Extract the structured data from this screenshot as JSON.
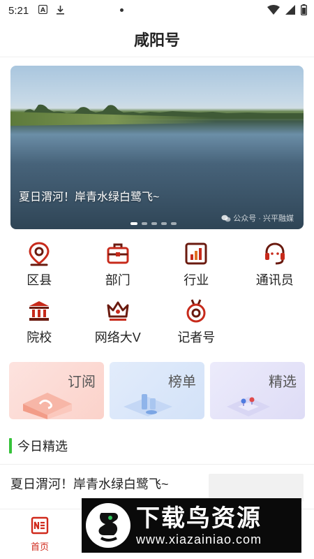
{
  "status_bar": {
    "time": "5:21"
  },
  "header": {
    "title": "咸阳号"
  },
  "banner": {
    "caption": "夏日渭河！岸青水绿白鹭飞~",
    "watermark": "公众号 · 兴平融媒",
    "page_count": 5,
    "active_page": 1
  },
  "categories": [
    {
      "label": "区县",
      "icon": "location-pin-icon"
    },
    {
      "label": "部门",
      "icon": "briefcase-icon"
    },
    {
      "label": "行业",
      "icon": "bar-chart-icon"
    },
    {
      "label": "通讯员",
      "icon": "headset-icon"
    },
    {
      "label": "院校",
      "icon": "institution-icon"
    },
    {
      "label": "网络大V",
      "icon": "crown-icon"
    },
    {
      "label": "记者号",
      "icon": "medal-icon"
    }
  ],
  "cards": [
    {
      "label": "订阅"
    },
    {
      "label": "榜单"
    },
    {
      "label": "精选"
    }
  ],
  "section": {
    "title": "今日精选"
  },
  "articles": [
    {
      "title": "夏日渭河！岸青水绿白鹭飞~"
    }
  ],
  "tabbar": {
    "home_label": "首页"
  },
  "ad": {
    "title": "下载鸟资源",
    "url": "www.xiazainiao.com"
  },
  "colors": {
    "accent_red": "#d02a1c",
    "icon_dark": "#6a1a0f",
    "section_bar_green": "#36c23a"
  }
}
